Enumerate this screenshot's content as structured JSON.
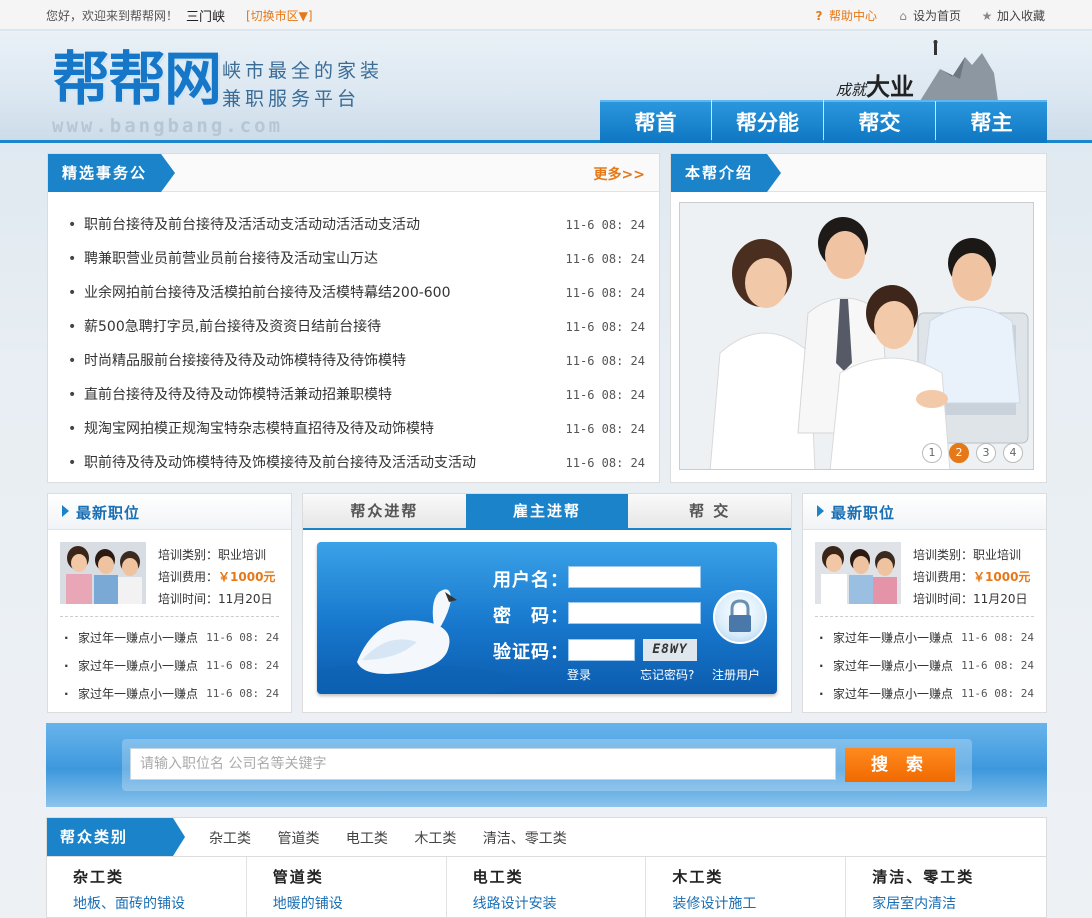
{
  "topbar": {
    "greeting": "您好，欢迎来到帮帮网！",
    "city": "三门峡",
    "switch_city": "[切换市区▼]",
    "help": "帮助中心",
    "set_home": "设为首页",
    "favorite": "加入收藏"
  },
  "header": {
    "logo": "帮帮网",
    "slogan_line1": "峡市最全的家装",
    "slogan_line2": "兼职服务平台",
    "domain": "www.bangbang.com",
    "deco_small": "成就",
    "deco_big": "大业"
  },
  "nav": [
    "帮首",
    "帮分能",
    "帮交",
    "帮主"
  ],
  "featured": {
    "title": "精选事务公",
    "more": "更多>>",
    "items": [
      {
        "text": "职前台接待及前台接待及活活动支活动动活活动支活动",
        "time": "11-6 08: 24"
      },
      {
        "text": "聘兼职营业员前营业员前台接待及活动宝山万达",
        "time": "11-6 08: 24"
      },
      {
        "text": "业余网拍前台接待及活模拍前台接待及活模特幕结200-600",
        "time": "11-6 08: 24"
      },
      {
        "text": "薪500急聘打字员,前台接待及资资日结前台接待",
        "time": "11-6 08: 24"
      },
      {
        "text": "时尚精品服前台接接待及待及动饰模特待及待饰模特",
        "time": "11-6 08: 24"
      },
      {
        "text": "直前台接待及待及待及动饰模特活兼动招兼职模特",
        "time": "11-6 08: 24"
      },
      {
        "text": "规淘宝网拍模正规淘宝特杂志模特直招待及待及动饰模特",
        "time": "11-6 08: 24"
      },
      {
        "text": "职前待及待及动饰模特待及饰模接待及前台接待及活活动支活动",
        "time": "11-6 08: 24"
      }
    ]
  },
  "intro": {
    "title": "本帮介绍",
    "pages": [
      "1",
      "2",
      "3",
      "4"
    ],
    "active_page": 1
  },
  "left_jobs": {
    "title": "最新职位",
    "category": "培训类别：职业培训",
    "fee_label": "培训费用：",
    "fee": "￥1000元",
    "time": "培训时间：11月20日",
    "items": [
      {
        "text": "家过年一赚点小一赚点",
        "time": "11-6 08: 24"
      },
      {
        "text": "家过年一赚点小一赚点",
        "time": "11-6 08: 24"
      },
      {
        "text": "家过年一赚点小一赚点",
        "time": "11-6 08: 24"
      }
    ]
  },
  "right_jobs": {
    "title": "最新职位",
    "category": "培训类别：职业培训",
    "fee_label": "培训费用：",
    "fee": "￥1000元",
    "time": "培训时间：11月20日",
    "items": [
      {
        "text": "家过年一赚点小一赚点",
        "time": "11-6 08: 24"
      },
      {
        "text": "家过年一赚点小一赚点",
        "time": "11-6 08: 24"
      },
      {
        "text": "家过年一赚点小一赚点",
        "time": "11-6 08: 24"
      }
    ]
  },
  "login": {
    "tabs": [
      "帮众进帮",
      "雇主进帮",
      "帮 交"
    ],
    "active_tab": 1,
    "username_label": "用户名：",
    "password_label": "密　码：",
    "captcha_label": "验证码：",
    "captcha_text": "E8WY",
    "login": "登录",
    "forgot": "忘记密码?",
    "register": "注册用户"
  },
  "search": {
    "placeholder": "请输入职位名 公司名等关键字",
    "button": "搜 索"
  },
  "categories": {
    "title": "帮众类别",
    "tabs": [
      "杂工类",
      "管道类",
      "电工类",
      "木工类",
      "清洁、零工类"
    ],
    "columns": [
      {
        "head": "杂工类",
        "sub": "地板、面砖的铺设"
      },
      {
        "head": "管道类",
        "sub": "地暖的铺设"
      },
      {
        "head": "电工类",
        "sub": "线路设计安装"
      },
      {
        "head": "木工类",
        "sub": "装修设计施工"
      },
      {
        "head": "清洁、零工类",
        "sub": "家居室内清洁"
      }
    ]
  },
  "colors": {
    "brand_blue": "#1a83ca",
    "accent_orange": "#e67817"
  }
}
